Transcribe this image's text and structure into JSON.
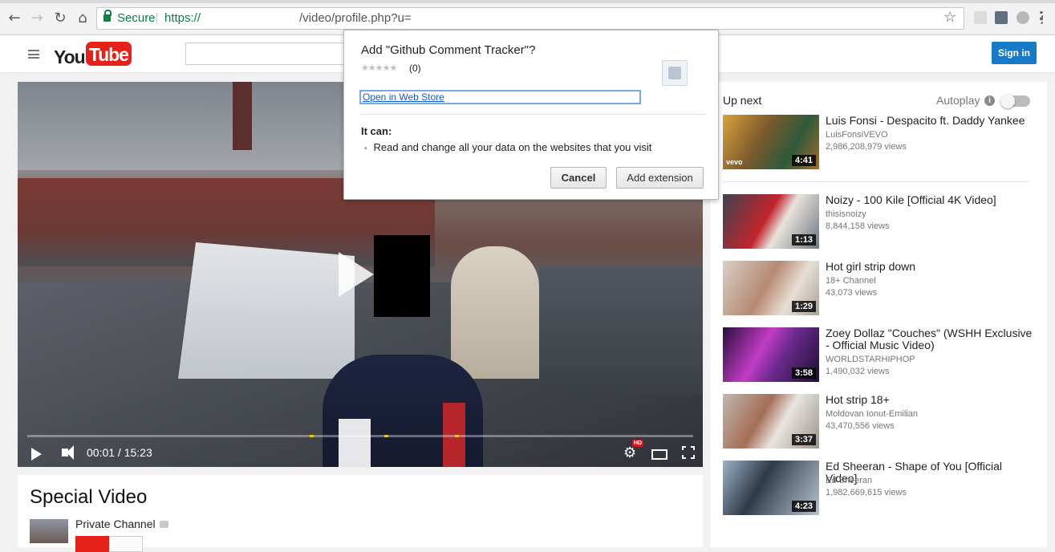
{
  "browser": {
    "secure_label": "Secure",
    "url_scheme": "https://",
    "url_path": "/video/profile.php?u="
  },
  "youtube": {
    "logo_you": "You",
    "logo_tube": "Tube",
    "signin_label": "Sign in"
  },
  "player": {
    "time": "00:01 / 15:23",
    "hd_badge": "HD",
    "progress_fraction": 0.001
  },
  "video": {
    "title": "Special Video",
    "channel": "Private Channel"
  },
  "sidebar": {
    "up_next": "Up next",
    "autoplay": "Autoplay",
    "videos": [
      {
        "title": "Luis Fonsi - Despacito ft. Daddy Yankee",
        "channel": "LuisFonsiVEVO",
        "views": "2,986,208,979 views",
        "duration": "4:41"
      },
      {
        "title": "Noizy - 100 Kile [Official 4K Video]",
        "channel": "thisisnoizy",
        "views": "8,844,158 views",
        "duration": "1:13"
      },
      {
        "title": "Hot girl strip down",
        "channel": "18+ Channel",
        "views": "43,073 views",
        "duration": "1:29"
      },
      {
        "title": "Zoey Dollaz \"Couches\" (WSHH Exclusive - Official Music Video)",
        "channel": "WORLDSTARHIPHOP",
        "views": "1,490,032 views",
        "duration": "3:58"
      },
      {
        "title": "Hot strip 18+",
        "channel": "Moldovan Ionut-Emilian",
        "views": "43,470,556 views",
        "duration": "3:37"
      },
      {
        "title": "Ed Sheeran - Shape of You [Official Video]",
        "channel": "Ed Sheeran",
        "views": "1,982,669,615 views",
        "duration": "4:23"
      }
    ]
  },
  "dialog": {
    "title": "Add \"Github Comment Tracker\"?",
    "stars": "★★★★★",
    "rating": "(0)",
    "webstore_link": "Open in Web Store",
    "it_can": "It can:",
    "permission": "Read and change all your data on the websites that you visit",
    "cancel": "Cancel",
    "add": "Add extension"
  }
}
